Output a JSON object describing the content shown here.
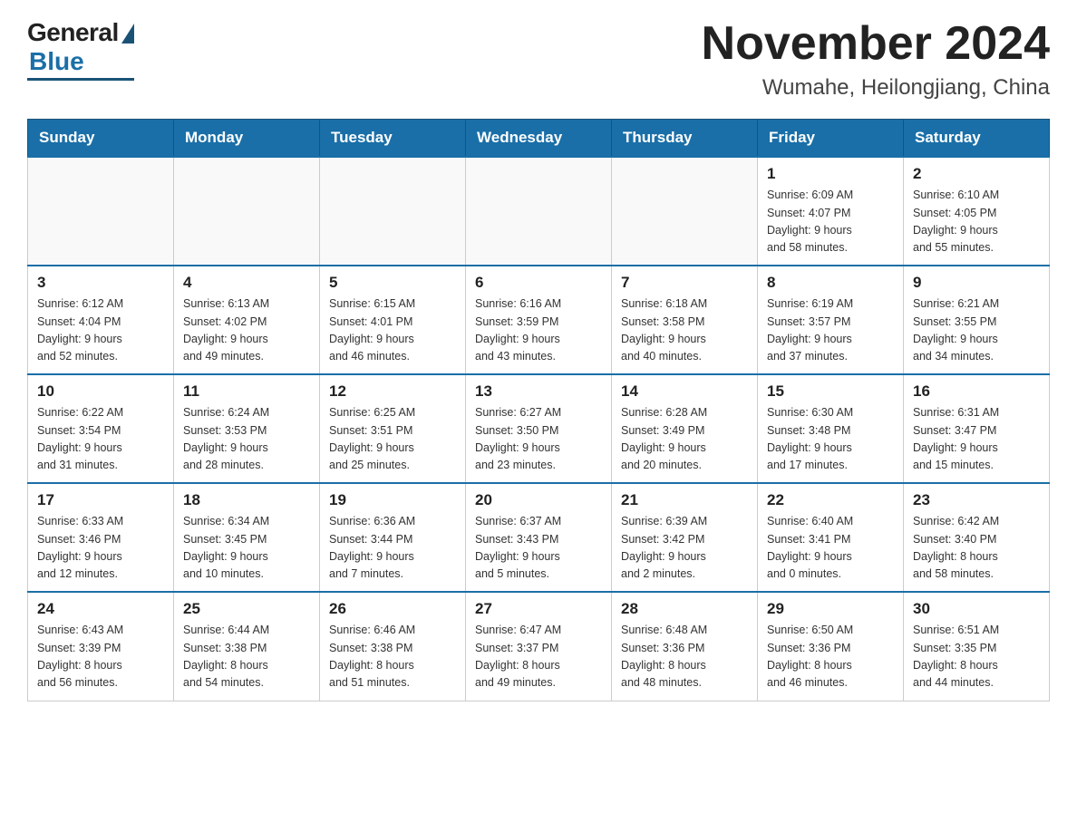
{
  "logo": {
    "general": "General",
    "blue": "Blue"
  },
  "header": {
    "month": "November 2024",
    "location": "Wumahe, Heilongjiang, China"
  },
  "weekdays": [
    "Sunday",
    "Monday",
    "Tuesday",
    "Wednesday",
    "Thursday",
    "Friday",
    "Saturday"
  ],
  "weeks": [
    [
      {
        "day": "",
        "info": ""
      },
      {
        "day": "",
        "info": ""
      },
      {
        "day": "",
        "info": ""
      },
      {
        "day": "",
        "info": ""
      },
      {
        "day": "",
        "info": ""
      },
      {
        "day": "1",
        "info": "Sunrise: 6:09 AM\nSunset: 4:07 PM\nDaylight: 9 hours\nand 58 minutes."
      },
      {
        "day": "2",
        "info": "Sunrise: 6:10 AM\nSunset: 4:05 PM\nDaylight: 9 hours\nand 55 minutes."
      }
    ],
    [
      {
        "day": "3",
        "info": "Sunrise: 6:12 AM\nSunset: 4:04 PM\nDaylight: 9 hours\nand 52 minutes."
      },
      {
        "day": "4",
        "info": "Sunrise: 6:13 AM\nSunset: 4:02 PM\nDaylight: 9 hours\nand 49 minutes."
      },
      {
        "day": "5",
        "info": "Sunrise: 6:15 AM\nSunset: 4:01 PM\nDaylight: 9 hours\nand 46 minutes."
      },
      {
        "day": "6",
        "info": "Sunrise: 6:16 AM\nSunset: 3:59 PM\nDaylight: 9 hours\nand 43 minutes."
      },
      {
        "day": "7",
        "info": "Sunrise: 6:18 AM\nSunset: 3:58 PM\nDaylight: 9 hours\nand 40 minutes."
      },
      {
        "day": "8",
        "info": "Sunrise: 6:19 AM\nSunset: 3:57 PM\nDaylight: 9 hours\nand 37 minutes."
      },
      {
        "day": "9",
        "info": "Sunrise: 6:21 AM\nSunset: 3:55 PM\nDaylight: 9 hours\nand 34 minutes."
      }
    ],
    [
      {
        "day": "10",
        "info": "Sunrise: 6:22 AM\nSunset: 3:54 PM\nDaylight: 9 hours\nand 31 minutes."
      },
      {
        "day": "11",
        "info": "Sunrise: 6:24 AM\nSunset: 3:53 PM\nDaylight: 9 hours\nand 28 minutes."
      },
      {
        "day": "12",
        "info": "Sunrise: 6:25 AM\nSunset: 3:51 PM\nDaylight: 9 hours\nand 25 minutes."
      },
      {
        "day": "13",
        "info": "Sunrise: 6:27 AM\nSunset: 3:50 PM\nDaylight: 9 hours\nand 23 minutes."
      },
      {
        "day": "14",
        "info": "Sunrise: 6:28 AM\nSunset: 3:49 PM\nDaylight: 9 hours\nand 20 minutes."
      },
      {
        "day": "15",
        "info": "Sunrise: 6:30 AM\nSunset: 3:48 PM\nDaylight: 9 hours\nand 17 minutes."
      },
      {
        "day": "16",
        "info": "Sunrise: 6:31 AM\nSunset: 3:47 PM\nDaylight: 9 hours\nand 15 minutes."
      }
    ],
    [
      {
        "day": "17",
        "info": "Sunrise: 6:33 AM\nSunset: 3:46 PM\nDaylight: 9 hours\nand 12 minutes."
      },
      {
        "day": "18",
        "info": "Sunrise: 6:34 AM\nSunset: 3:45 PM\nDaylight: 9 hours\nand 10 minutes."
      },
      {
        "day": "19",
        "info": "Sunrise: 6:36 AM\nSunset: 3:44 PM\nDaylight: 9 hours\nand 7 minutes."
      },
      {
        "day": "20",
        "info": "Sunrise: 6:37 AM\nSunset: 3:43 PM\nDaylight: 9 hours\nand 5 minutes."
      },
      {
        "day": "21",
        "info": "Sunrise: 6:39 AM\nSunset: 3:42 PM\nDaylight: 9 hours\nand 2 minutes."
      },
      {
        "day": "22",
        "info": "Sunrise: 6:40 AM\nSunset: 3:41 PM\nDaylight: 9 hours\nand 0 minutes."
      },
      {
        "day": "23",
        "info": "Sunrise: 6:42 AM\nSunset: 3:40 PM\nDaylight: 8 hours\nand 58 minutes."
      }
    ],
    [
      {
        "day": "24",
        "info": "Sunrise: 6:43 AM\nSunset: 3:39 PM\nDaylight: 8 hours\nand 56 minutes."
      },
      {
        "day": "25",
        "info": "Sunrise: 6:44 AM\nSunset: 3:38 PM\nDaylight: 8 hours\nand 54 minutes."
      },
      {
        "day": "26",
        "info": "Sunrise: 6:46 AM\nSunset: 3:38 PM\nDaylight: 8 hours\nand 51 minutes."
      },
      {
        "day": "27",
        "info": "Sunrise: 6:47 AM\nSunset: 3:37 PM\nDaylight: 8 hours\nand 49 minutes."
      },
      {
        "day": "28",
        "info": "Sunrise: 6:48 AM\nSunset: 3:36 PM\nDaylight: 8 hours\nand 48 minutes."
      },
      {
        "day": "29",
        "info": "Sunrise: 6:50 AM\nSunset: 3:36 PM\nDaylight: 8 hours\nand 46 minutes."
      },
      {
        "day": "30",
        "info": "Sunrise: 6:51 AM\nSunset: 3:35 PM\nDaylight: 8 hours\nand 44 minutes."
      }
    ]
  ]
}
